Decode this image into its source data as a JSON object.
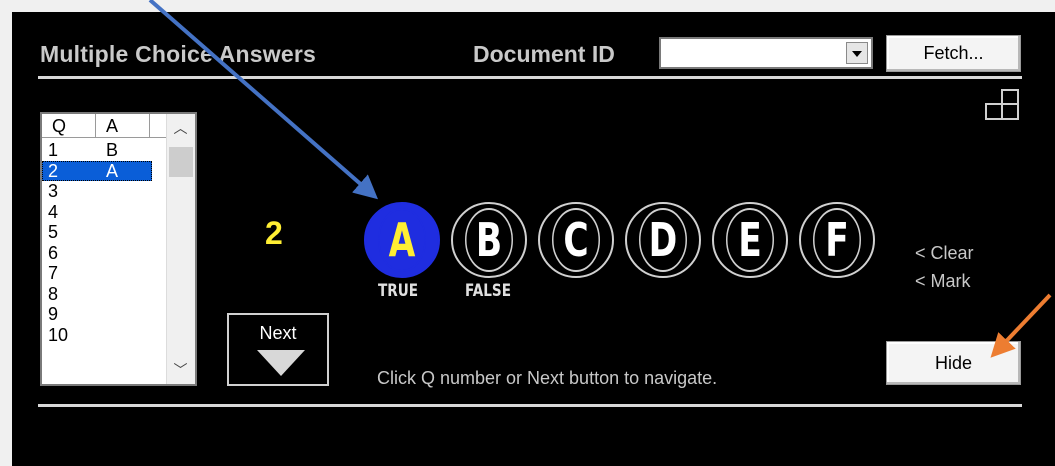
{
  "header": {
    "title": "Multiple Choice Answers",
    "doc_id_label": "Document ID",
    "doc_id_value": "",
    "fetch_label": "Fetch..."
  },
  "question_list": {
    "columns": [
      "Q",
      "A"
    ],
    "rows": [
      {
        "q": "1",
        "a": "B"
      },
      {
        "q": "2",
        "a": "A"
      },
      {
        "q": "3",
        "a": ""
      },
      {
        "q": "4",
        "a": ""
      },
      {
        "q": "5",
        "a": ""
      },
      {
        "q": "6",
        "a": ""
      },
      {
        "q": "7",
        "a": ""
      },
      {
        "q": "8",
        "a": ""
      },
      {
        "q": "9",
        "a": ""
      },
      {
        "q": "10",
        "a": ""
      }
    ],
    "selected_index": 1
  },
  "current_question": "2",
  "options": [
    {
      "letter": "A",
      "label": "TRUE",
      "selected": true
    },
    {
      "letter": "B",
      "label": "FALSE",
      "selected": false
    },
    {
      "letter": "C",
      "label": "",
      "selected": false
    },
    {
      "letter": "D",
      "label": "",
      "selected": false
    },
    {
      "letter": "E",
      "label": "",
      "selected": false
    },
    {
      "letter": "F",
      "label": "",
      "selected": false
    }
  ],
  "side_links": {
    "clear": "< Clear",
    "mark": "< Mark"
  },
  "next_label": "Next",
  "nav_hint": "Click Q number or Next button to navigate.",
  "hide_label": "Hide",
  "colors": {
    "selected_bubble": "#1f2de0",
    "selected_letter": "#ffee33",
    "blue_arrow": "#4472c4",
    "orange_arrow": "#ed7d31"
  }
}
